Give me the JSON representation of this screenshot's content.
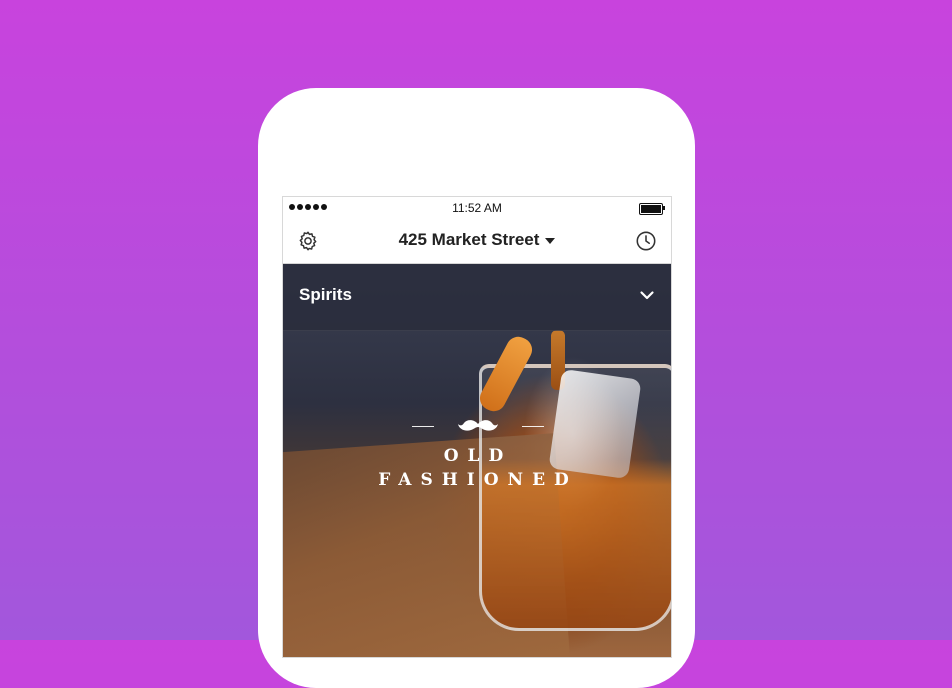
{
  "status_bar": {
    "time": "11:52 AM",
    "signal_icon": "signal-dots-icon",
    "battery_icon": "battery-icon"
  },
  "nav": {
    "location": "425 Market Street",
    "settings_icon": "gear-icon",
    "history_icon": "clock-icon",
    "dropdown_icon": "caret-down-icon"
  },
  "category": {
    "label": "Spirits",
    "chevron_icon": "chevron-down-icon"
  },
  "featured_drink": {
    "name_line1": "OLD",
    "name_line2": "FASHIONED",
    "logo_icon": "mustache-icon"
  },
  "pager": {
    "active_index": 0,
    "page_count": 4
  },
  "colors": {
    "background_top": "#c843dd",
    "background_bottom": "#a257dc",
    "phone_body": "#ffffff",
    "category_bar": "#282b3a"
  }
}
